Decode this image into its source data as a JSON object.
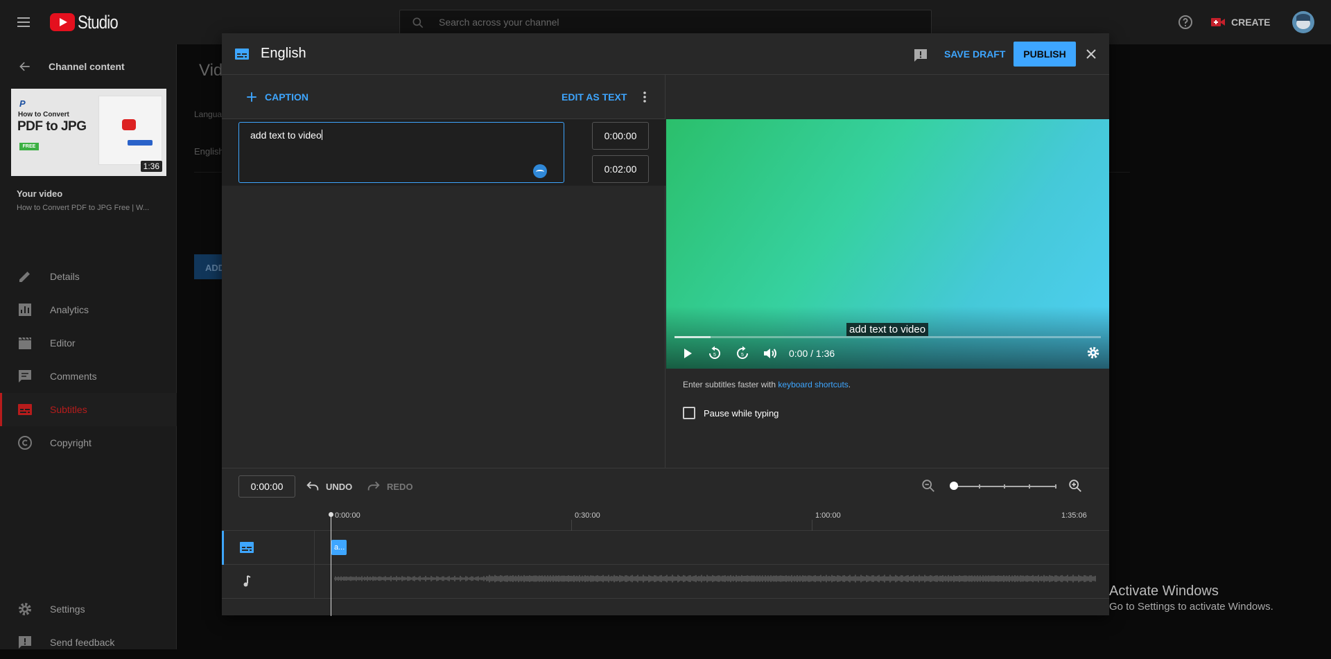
{
  "topbar": {
    "logo_text": "Studio",
    "search_placeholder": "Search across your channel",
    "create_label": "CREATE"
  },
  "sidebar": {
    "back_label": "Channel content",
    "thumbnail": {
      "line1": "How to Convert",
      "line2": "PDF to JPG",
      "badge": "FREE",
      "duration": "1:36"
    },
    "your_video_label": "Your video",
    "video_title": "How to Convert PDF to JPG Free | W...",
    "items": [
      {
        "label": "Details",
        "icon": "pencil-icon"
      },
      {
        "label": "Analytics",
        "icon": "analytics-icon"
      },
      {
        "label": "Editor",
        "icon": "clapperboard-icon"
      },
      {
        "label": "Comments",
        "icon": "comment-icon"
      },
      {
        "label": "Subtitles",
        "icon": "subtitles-icon",
        "active": true
      },
      {
        "label": "Copyright",
        "icon": "copyright-icon"
      }
    ],
    "bottom_items": [
      {
        "label": "Settings",
        "icon": "gear-icon"
      },
      {
        "label": "Send feedback",
        "icon": "feedback-icon"
      }
    ]
  },
  "behind": {
    "title": "Vid",
    "language_label": "Langua",
    "english_label": "English",
    "add_button": "ADD"
  },
  "modal": {
    "title": "English",
    "save_draft_label": "SAVE DRAFT",
    "publish_label": "PUBLISH",
    "add_caption_label": "CAPTION",
    "edit_as_text_label": "EDIT AS TEXT",
    "caption": {
      "text": "add text to video",
      "start": "0:00:00",
      "end": "0:02:00"
    },
    "player": {
      "subtitle_overlay": "add text to video",
      "time_display": "0:00 / 1:36",
      "progress_fraction": 0.085
    },
    "hint_prefix": "Enter subtitles faster with ",
    "hint_link": "keyboard shortcuts",
    "hint_suffix": ".",
    "pause_label": "Pause while typing",
    "timeline": {
      "current_time": "0:00:00",
      "undo_label": "UNDO",
      "redo_label": "REDO",
      "ruler_labels": [
        "0:00:00",
        "0:30:00",
        "1:00:00",
        "1:35:06"
      ],
      "chip_text": "a..."
    }
  },
  "watermark": {
    "line1": "Activate Windows",
    "line2": "Go to Settings to activate Windows."
  },
  "colors": {
    "accent": "#3ea6ff",
    "active_red": "#b71c1c",
    "background": "#0a0a0a",
    "panel": "#282828"
  }
}
